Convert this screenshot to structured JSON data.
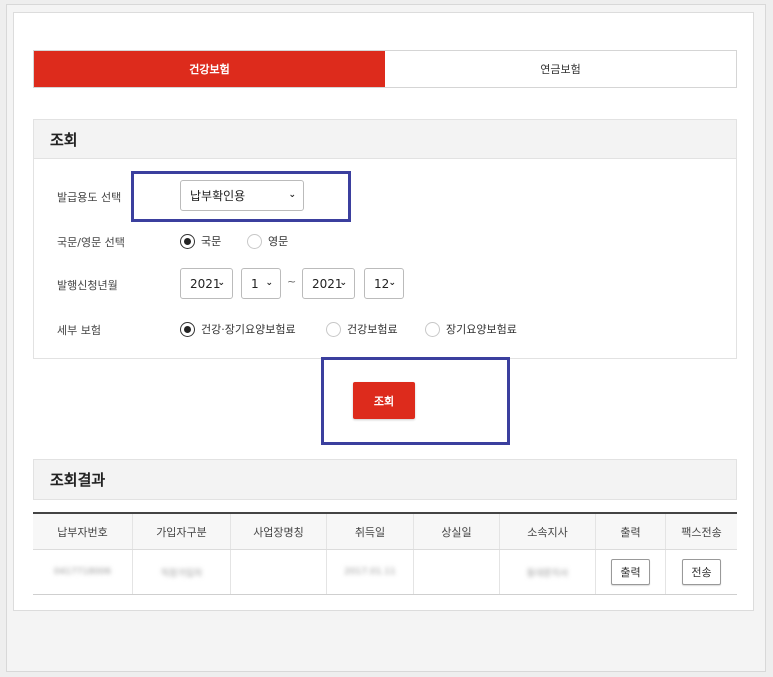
{
  "tabs": [
    {
      "label": "건강보험",
      "active": true
    },
    {
      "label": "연금보험",
      "active": false
    }
  ],
  "query": {
    "title": "조회",
    "purpose": {
      "label": "발급용도 선택",
      "value": "납부확인용"
    },
    "language": {
      "label": "국문/영문 선택",
      "options": [
        "국문",
        "영문"
      ],
      "selected": "국문"
    },
    "period": {
      "label": "발행신청년월",
      "from_year": "2021",
      "from_month": "1",
      "separator": "~",
      "to_year": "2021",
      "to_month": "12"
    },
    "insurance": {
      "label": "세부 보험",
      "options": [
        "건강·장기요양보험료",
        "건강보험료",
        "장기요양보험료"
      ],
      "selected": "건강·장기요양보험료"
    },
    "search_button": "조회"
  },
  "results": {
    "title": "조회결과",
    "columns": [
      "납부자번호",
      "가입자구분",
      "사업장명칭",
      "취득일",
      "상실일",
      "소속지사",
      "출력",
      "팩스전송"
    ],
    "rows": [
      {
        "payer_no": "0417718006",
        "member_type": "직장가입자",
        "workplace": "",
        "acquired": "2017.01.11",
        "lost": "",
        "branch": "동대문지사",
        "print_button": "출력",
        "fax_button": "전송"
      }
    ]
  },
  "colors": {
    "accent": "#dd2b1c",
    "highlight": "#3b3f9e"
  }
}
